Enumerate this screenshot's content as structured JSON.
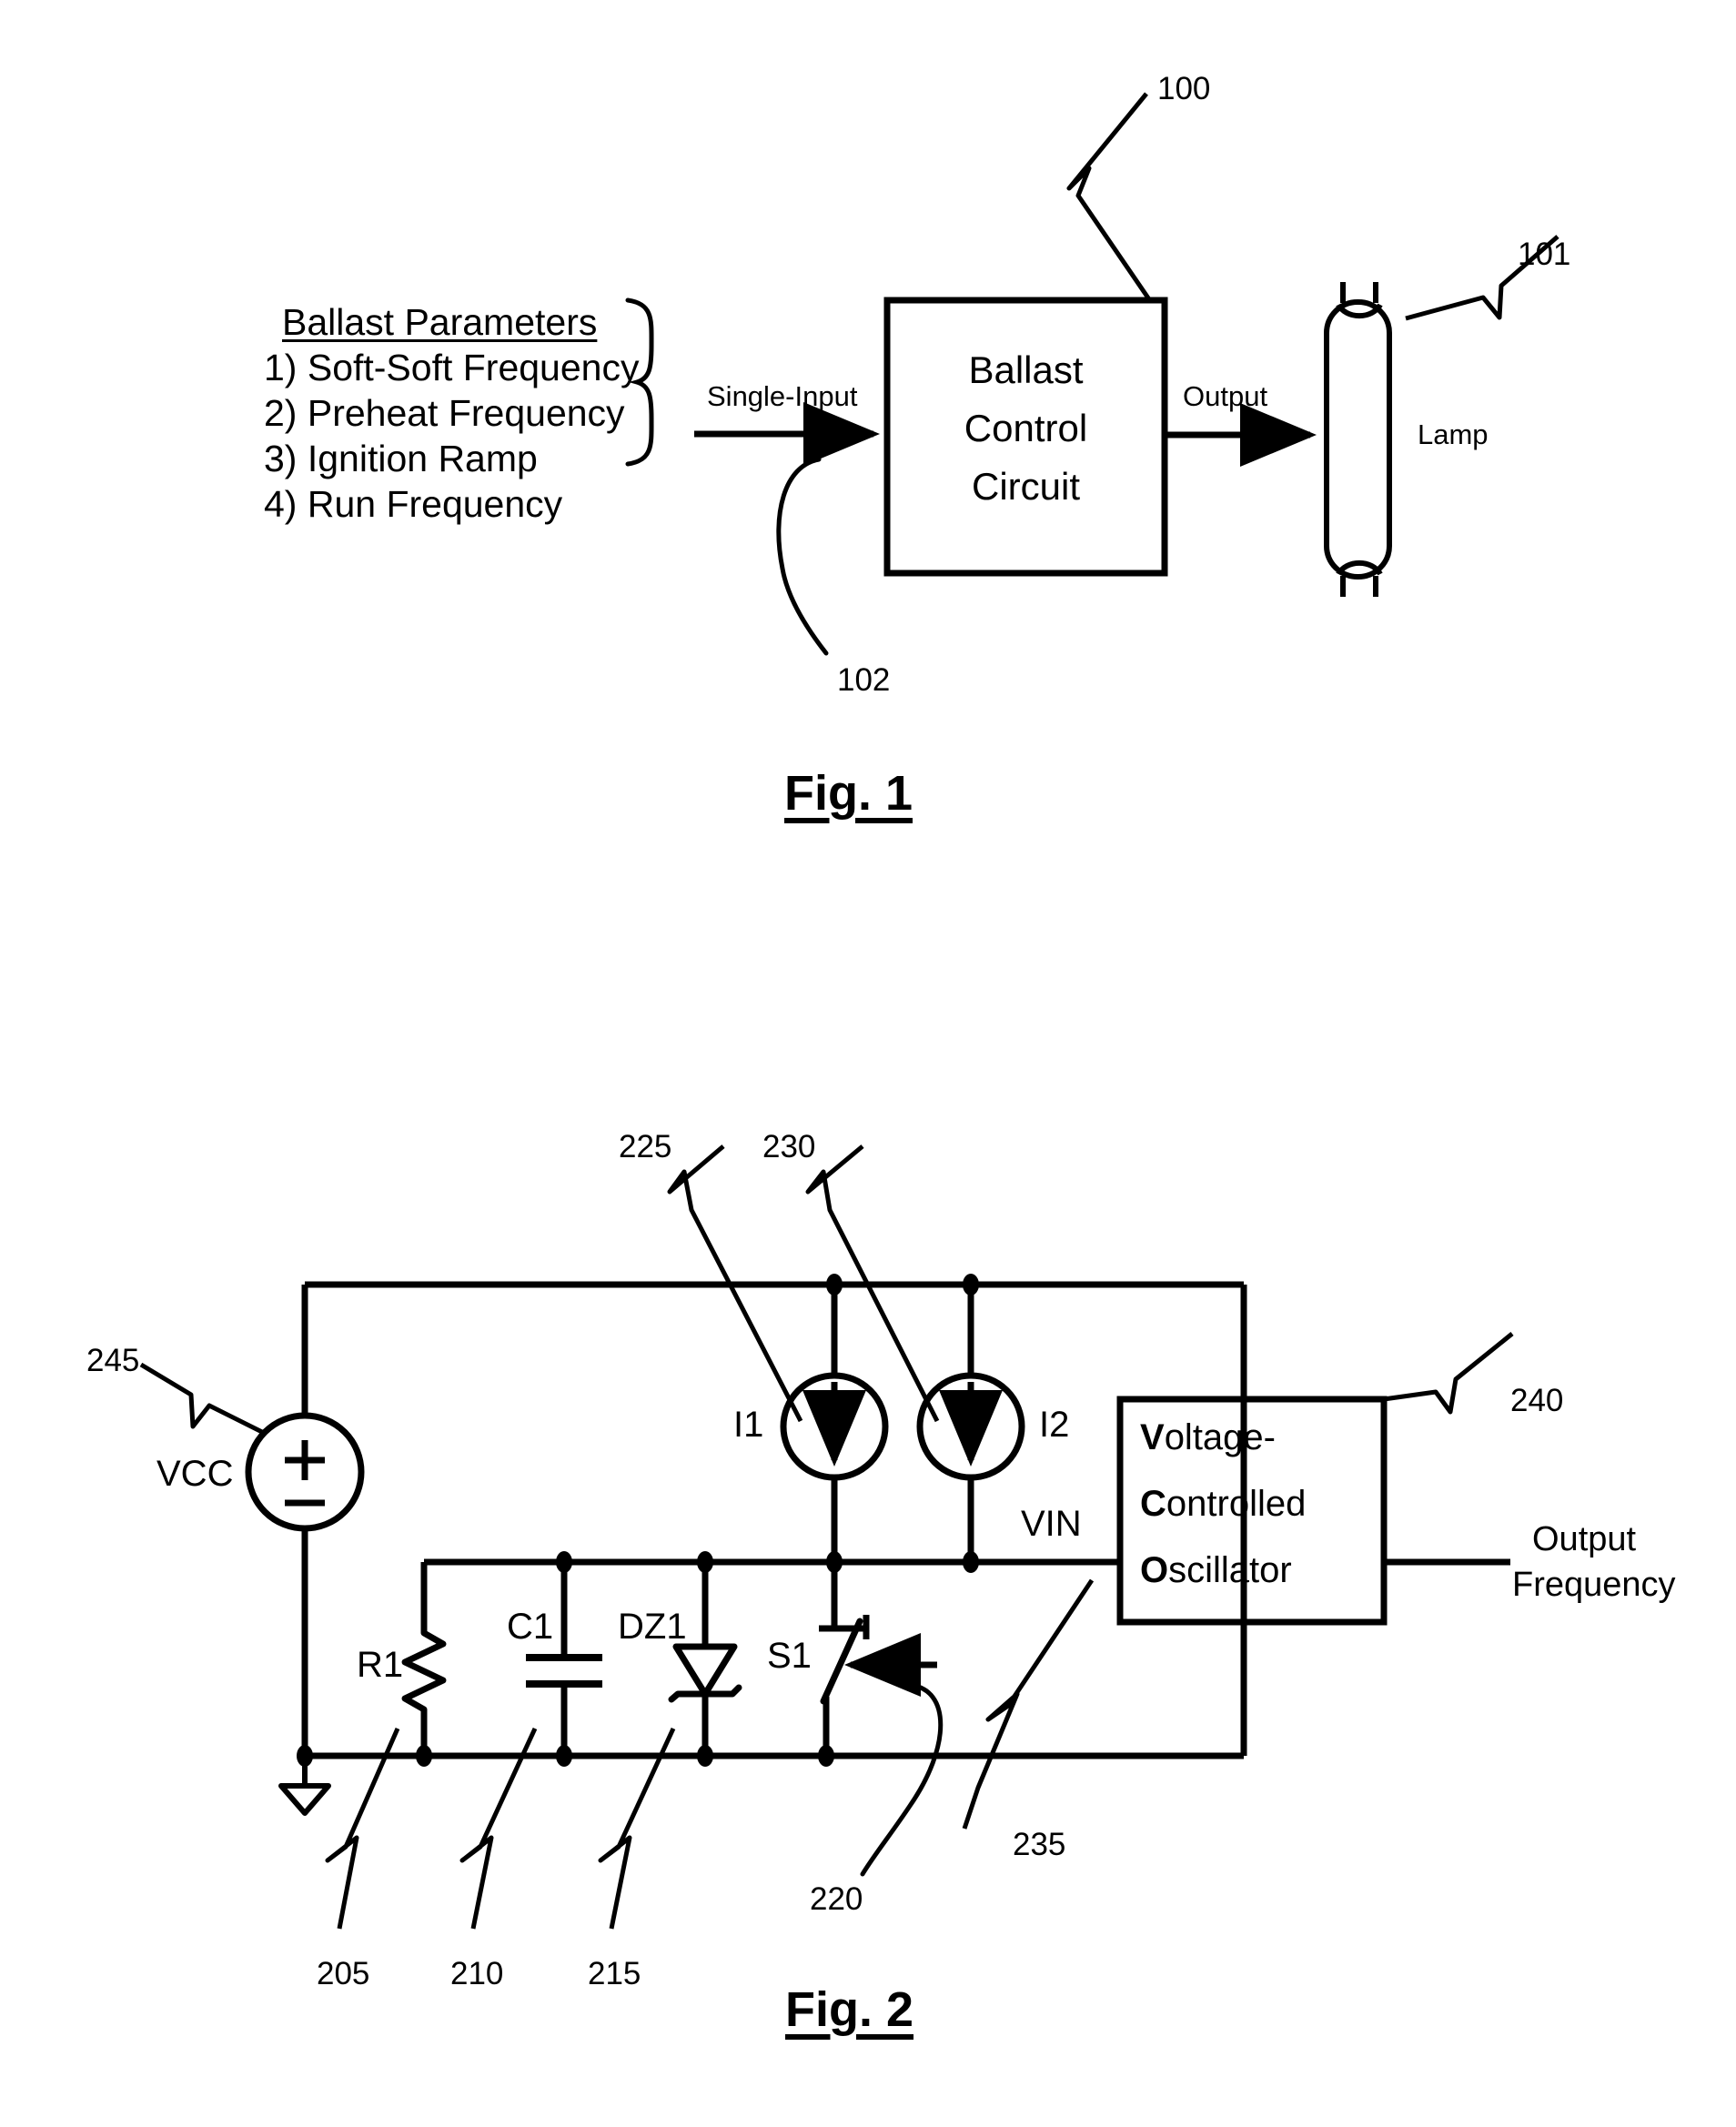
{
  "figure1": {
    "caption": "Fig. 1",
    "parameters_title": "Ballast Parameters",
    "parameters": [
      "1) Soft-Soft Frequency",
      "2) Preheat Frequency",
      "3) Ignition Ramp",
      "4) Run Frequency"
    ],
    "input_label": "Single-Input",
    "output_label": "Output",
    "block_lines": [
      "Ballast",
      "Control",
      "Circuit"
    ],
    "lamp_label": "Lamp",
    "refs": {
      "block": "100",
      "lamp": "101",
      "input_line": "102"
    }
  },
  "figure2": {
    "caption": "Fig. 2",
    "supply_label": "VCC",
    "supply_plus": "+",
    "supply_minus": "–",
    "components": {
      "resistor": "R1",
      "capacitor": "C1",
      "zener": "DZ1",
      "switch": "S1",
      "source1": "I1",
      "source2": "I2"
    },
    "vin_label": "VIN",
    "vco_lines": [
      {
        "bold": "V",
        "rest": "oltage-"
      },
      {
        "bold": "C",
        "rest": "ontrolled"
      },
      {
        "bold": "O",
        "rest": "scillator"
      }
    ],
    "output_lines": [
      "Output",
      "Frequency"
    ],
    "refs": {
      "resistor": "205",
      "capacitor": "210",
      "zener": "215",
      "switch": "220",
      "source1": "225",
      "source2": "230",
      "vin": "235",
      "vco": "240",
      "supply": "245"
    }
  },
  "style": {
    "ink": "#000000",
    "paper": "#ffffff"
  }
}
